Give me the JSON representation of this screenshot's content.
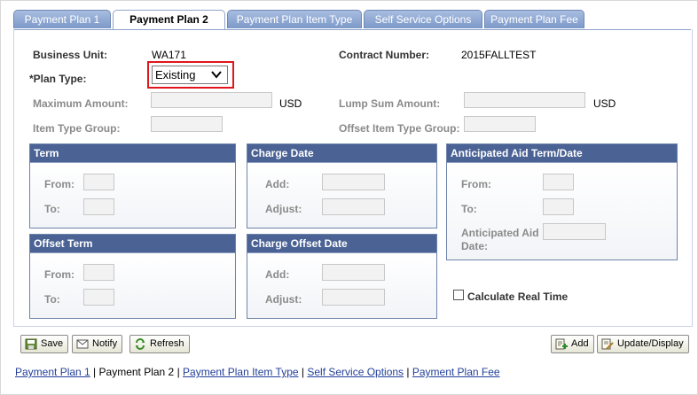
{
  "tabs": [
    {
      "label": "Payment Plan 1",
      "active": false
    },
    {
      "label": "Payment Plan 2",
      "active": true
    },
    {
      "label": "Payment Plan Item Type",
      "active": false
    },
    {
      "label": "Self Service Options",
      "active": false
    },
    {
      "label": "Payment Plan Fee",
      "active": false
    }
  ],
  "header": {
    "business_unit_label": "Business Unit:",
    "business_unit_value": "WA171",
    "contract_number_label": "Contract Number:",
    "contract_number_value": "2015FALLTEST",
    "plan_type_label": "*Plan Type:",
    "plan_type_value": "Existing",
    "maximum_amount_label": "Maximum Amount:",
    "maximum_amount_currency": "USD",
    "lump_sum_amount_label": "Lump Sum Amount:",
    "lump_sum_amount_currency": "USD",
    "item_type_group_label": "Item Type Group:",
    "offset_item_type_group_label": "Offset Item Type Group:"
  },
  "groups": {
    "term": {
      "title": "Term",
      "from_label": "From:",
      "to_label": "To:"
    },
    "charge_date": {
      "title": "Charge Date",
      "add_label": "Add:",
      "adjust_label": "Adjust:"
    },
    "anticipated_aid": {
      "title": "Anticipated Aid Term/Date",
      "from_label": "From:",
      "to_label": "To:",
      "date_label_line1": "Anticipated Aid",
      "date_label_line2": "Date:"
    },
    "offset_term": {
      "title": "Offset Term",
      "from_label": "From:",
      "to_label": "To:"
    },
    "charge_offset_date": {
      "title": "Charge Offset Date",
      "add_label": "Add:",
      "adjust_label": "Adjust:"
    }
  },
  "calculate_real_time_label": "Calculate Real Time",
  "calculate_real_time_checked": false,
  "toolbar": {
    "save_label": "Save",
    "notify_label": "Notify",
    "refresh_label": "Refresh",
    "add_label": "Add",
    "update_display_label": "Update/Display"
  },
  "footer_links": {
    "link1": "Payment Plan 1",
    "current": "Payment Plan 2",
    "link3": "Payment Plan Item Type",
    "link4": "Self Service Options",
    "link5": "Payment Plan Fee",
    "separator": " | "
  },
  "colors": {
    "group_header": "#4a6294",
    "tab_bg": "#7d99c9",
    "highlight": "#e0161b",
    "link": "#23409a"
  }
}
